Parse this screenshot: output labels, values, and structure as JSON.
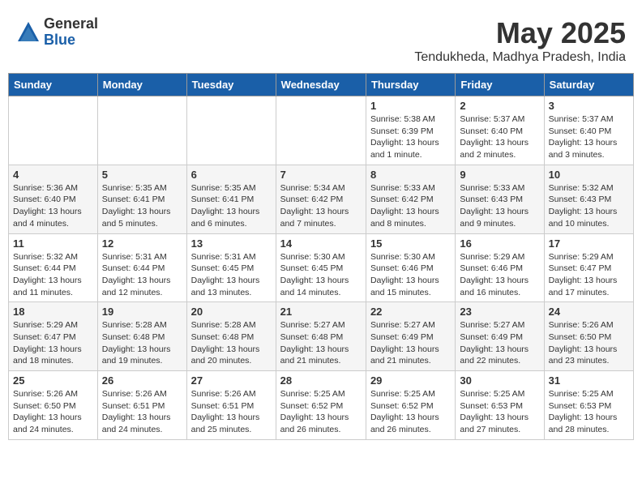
{
  "logo": {
    "general": "General",
    "blue": "Blue"
  },
  "title": {
    "month": "May 2025",
    "location": "Tendukheda, Madhya Pradesh, India"
  },
  "days_of_week": [
    "Sunday",
    "Monday",
    "Tuesday",
    "Wednesday",
    "Thursday",
    "Friday",
    "Saturday"
  ],
  "weeks": [
    [
      {
        "day": "",
        "info": ""
      },
      {
        "day": "",
        "info": ""
      },
      {
        "day": "",
        "info": ""
      },
      {
        "day": "",
        "info": ""
      },
      {
        "day": "1",
        "info": "Sunrise: 5:38 AM\nSunset: 6:39 PM\nDaylight: 13 hours\nand 1 minute."
      },
      {
        "day": "2",
        "info": "Sunrise: 5:37 AM\nSunset: 6:40 PM\nDaylight: 13 hours\nand 2 minutes."
      },
      {
        "day": "3",
        "info": "Sunrise: 5:37 AM\nSunset: 6:40 PM\nDaylight: 13 hours\nand 3 minutes."
      }
    ],
    [
      {
        "day": "4",
        "info": "Sunrise: 5:36 AM\nSunset: 6:40 PM\nDaylight: 13 hours\nand 4 minutes."
      },
      {
        "day": "5",
        "info": "Sunrise: 5:35 AM\nSunset: 6:41 PM\nDaylight: 13 hours\nand 5 minutes."
      },
      {
        "day": "6",
        "info": "Sunrise: 5:35 AM\nSunset: 6:41 PM\nDaylight: 13 hours\nand 6 minutes."
      },
      {
        "day": "7",
        "info": "Sunrise: 5:34 AM\nSunset: 6:42 PM\nDaylight: 13 hours\nand 7 minutes."
      },
      {
        "day": "8",
        "info": "Sunrise: 5:33 AM\nSunset: 6:42 PM\nDaylight: 13 hours\nand 8 minutes."
      },
      {
        "day": "9",
        "info": "Sunrise: 5:33 AM\nSunset: 6:43 PM\nDaylight: 13 hours\nand 9 minutes."
      },
      {
        "day": "10",
        "info": "Sunrise: 5:32 AM\nSunset: 6:43 PM\nDaylight: 13 hours\nand 10 minutes."
      }
    ],
    [
      {
        "day": "11",
        "info": "Sunrise: 5:32 AM\nSunset: 6:44 PM\nDaylight: 13 hours\nand 11 minutes."
      },
      {
        "day": "12",
        "info": "Sunrise: 5:31 AM\nSunset: 6:44 PM\nDaylight: 13 hours\nand 12 minutes."
      },
      {
        "day": "13",
        "info": "Sunrise: 5:31 AM\nSunset: 6:45 PM\nDaylight: 13 hours\nand 13 minutes."
      },
      {
        "day": "14",
        "info": "Sunrise: 5:30 AM\nSunset: 6:45 PM\nDaylight: 13 hours\nand 14 minutes."
      },
      {
        "day": "15",
        "info": "Sunrise: 5:30 AM\nSunset: 6:46 PM\nDaylight: 13 hours\nand 15 minutes."
      },
      {
        "day": "16",
        "info": "Sunrise: 5:29 AM\nSunset: 6:46 PM\nDaylight: 13 hours\nand 16 minutes."
      },
      {
        "day": "17",
        "info": "Sunrise: 5:29 AM\nSunset: 6:47 PM\nDaylight: 13 hours\nand 17 minutes."
      }
    ],
    [
      {
        "day": "18",
        "info": "Sunrise: 5:29 AM\nSunset: 6:47 PM\nDaylight: 13 hours\nand 18 minutes."
      },
      {
        "day": "19",
        "info": "Sunrise: 5:28 AM\nSunset: 6:48 PM\nDaylight: 13 hours\nand 19 minutes."
      },
      {
        "day": "20",
        "info": "Sunrise: 5:28 AM\nSunset: 6:48 PM\nDaylight: 13 hours\nand 20 minutes."
      },
      {
        "day": "21",
        "info": "Sunrise: 5:27 AM\nSunset: 6:48 PM\nDaylight: 13 hours\nand 21 minutes."
      },
      {
        "day": "22",
        "info": "Sunrise: 5:27 AM\nSunset: 6:49 PM\nDaylight: 13 hours\nand 21 minutes."
      },
      {
        "day": "23",
        "info": "Sunrise: 5:27 AM\nSunset: 6:49 PM\nDaylight: 13 hours\nand 22 minutes."
      },
      {
        "day": "24",
        "info": "Sunrise: 5:26 AM\nSunset: 6:50 PM\nDaylight: 13 hours\nand 23 minutes."
      }
    ],
    [
      {
        "day": "25",
        "info": "Sunrise: 5:26 AM\nSunset: 6:50 PM\nDaylight: 13 hours\nand 24 minutes."
      },
      {
        "day": "26",
        "info": "Sunrise: 5:26 AM\nSunset: 6:51 PM\nDaylight: 13 hours\nand 24 minutes."
      },
      {
        "day": "27",
        "info": "Sunrise: 5:26 AM\nSunset: 6:51 PM\nDaylight: 13 hours\nand 25 minutes."
      },
      {
        "day": "28",
        "info": "Sunrise: 5:25 AM\nSunset: 6:52 PM\nDaylight: 13 hours\nand 26 minutes."
      },
      {
        "day": "29",
        "info": "Sunrise: 5:25 AM\nSunset: 6:52 PM\nDaylight: 13 hours\nand 26 minutes."
      },
      {
        "day": "30",
        "info": "Sunrise: 5:25 AM\nSunset: 6:53 PM\nDaylight: 13 hours\nand 27 minutes."
      },
      {
        "day": "31",
        "info": "Sunrise: 5:25 AM\nSunset: 6:53 PM\nDaylight: 13 hours\nand 28 minutes."
      }
    ]
  ]
}
